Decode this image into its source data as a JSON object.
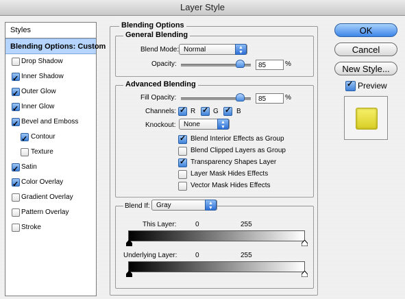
{
  "window": {
    "title": "Layer Style"
  },
  "styles_panel": {
    "header": "Styles",
    "selected": "Blending Options: Custom",
    "items": [
      {
        "label": "Drop Shadow",
        "checked": false
      },
      {
        "label": "Inner Shadow",
        "checked": true
      },
      {
        "label": "Outer Glow",
        "checked": true
      },
      {
        "label": "Inner Glow",
        "checked": true
      },
      {
        "label": "Bevel and Emboss",
        "checked": true
      },
      {
        "label": "Contour",
        "checked": true
      },
      {
        "label": "Texture",
        "checked": false
      },
      {
        "label": "Satin",
        "checked": true
      },
      {
        "label": "Color Overlay",
        "checked": true
      },
      {
        "label": "Gradient Overlay",
        "checked": false
      },
      {
        "label": "Pattern Overlay",
        "checked": false
      },
      {
        "label": "Stroke",
        "checked": false
      }
    ]
  },
  "blending": {
    "title": "Blending Options",
    "general": {
      "title": "General Blending",
      "blend_mode_label": "Blend Mode:",
      "blend_mode_value": "Normal",
      "opacity_label": "Opacity:",
      "opacity_value": "85",
      "opacity_unit": "%",
      "opacity_fraction": 0.85
    },
    "advanced": {
      "title": "Advanced Blending",
      "fill_opacity_label": "Fill Opacity:",
      "fill_opacity_value": "85",
      "fill_opacity_unit": "%",
      "fill_opacity_fraction": 0.85,
      "channels_label": "Channels:",
      "channel_r": "R",
      "channel_g": "G",
      "channel_b": "B",
      "knockout_label": "Knockout:",
      "knockout_value": "None",
      "options": [
        {
          "label": "Blend Interior Effects as Group",
          "checked": true
        },
        {
          "label": "Blend Clipped Layers as Group",
          "checked": false
        },
        {
          "label": "Transparency Shapes Layer",
          "checked": true
        },
        {
          "label": "Layer Mask Hides Effects",
          "checked": false
        },
        {
          "label": "Vector Mask Hides Effects",
          "checked": false
        }
      ]
    },
    "blend_if": {
      "label": "Blend If:",
      "value": "Gray",
      "this_layer_label": "This Layer:",
      "this_layer_min": "0",
      "this_layer_max": "255",
      "underlying_label": "Underlying Layer:",
      "underlying_min": "0",
      "underlying_max": "255"
    }
  },
  "buttons": {
    "ok": "OK",
    "cancel": "Cancel",
    "new_style": "New Style...",
    "preview_label": "Preview",
    "preview_checked": true
  },
  "colors": {
    "accent": "#3d86e8",
    "selection": "#b5d5ff",
    "preview_swatch": "#e8df3a"
  }
}
